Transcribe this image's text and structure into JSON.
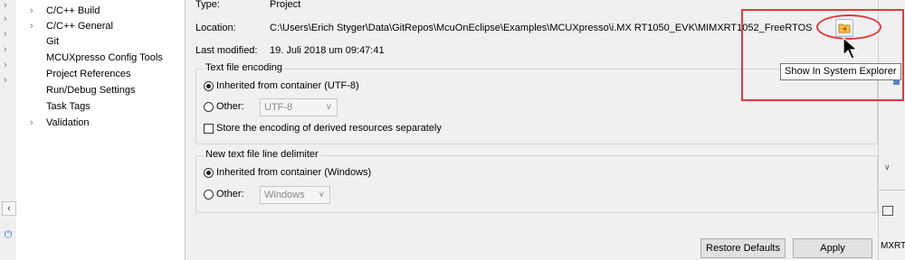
{
  "tree": {
    "items": [
      {
        "label": "C/C++ Build",
        "expander": "›"
      },
      {
        "label": "C/C++ General",
        "expander": "›"
      },
      {
        "label": "Git",
        "expander": ""
      },
      {
        "label": "MCUXpresso Config Tools",
        "expander": ""
      },
      {
        "label": "Project References",
        "expander": ""
      },
      {
        "label": "Run/Debug Settings",
        "expander": ""
      },
      {
        "label": "Task Tags",
        "expander": ""
      },
      {
        "label": "Validation",
        "expander": "›"
      }
    ]
  },
  "gutter": {
    "collapse_glyph": "‹",
    "power_glyph": "⏻",
    "chevron_glyph": "›"
  },
  "properties": {
    "type_label": "Type:",
    "type_value": "Project",
    "location_label": "Location:",
    "location_value": "C:\\Users\\Erich Styger\\Data\\GitRepos\\McuOnEclipse\\Examples\\MCUXpresso\\i.MX RT1050_EVK\\MIMXRT1052_FreeRTOS",
    "last_modified_label": "Last modified:",
    "last_modified_value": "19. Juli 2018 um 09:47:41",
    "show_in_explorer_icon": "folder-arrow-icon"
  },
  "encoding": {
    "legend": "Text file encoding",
    "inherited_label": "Inherited from container (UTF-8)",
    "other_label": "Other:",
    "other_value": "UTF-8",
    "store_derived_label": "Store the encoding of derived resources separately"
  },
  "delimiter": {
    "legend": "New text file line delimiter",
    "inherited_label": "Inherited from container (Windows)",
    "other_label": "Other:",
    "other_value": "Windows"
  },
  "buttons": {
    "restore_defaults": "Restore Defaults",
    "apply": "Apply"
  },
  "tooltip": {
    "text": "Show In System Explorer"
  },
  "right_strip": {
    "text": "MXRT"
  },
  "colors": {
    "annotation_red": "#e0393e",
    "accent": "#5b86c6"
  }
}
